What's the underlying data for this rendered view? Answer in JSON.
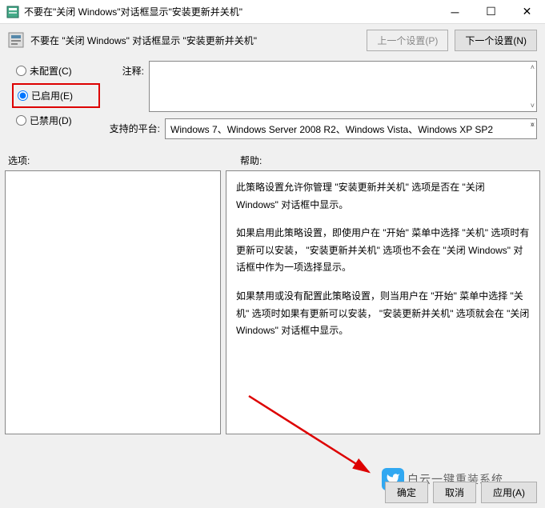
{
  "title": "不要在\"关闭 Windows\"对话框显示\"安装更新并关机\"",
  "header_title": "不要在 \"关闭 Windows\" 对话框显示 \"安装更新并关机\"",
  "nav": {
    "prev": "上一个设置(P)",
    "next": "下一个设置(N)"
  },
  "radios": {
    "not_configured": "未配置(C)",
    "enabled": "已启用(E)",
    "disabled": "已禁用(D)"
  },
  "labels": {
    "comment": "注释:",
    "platform": "支持的平台:",
    "options": "选项:",
    "help": "帮助:"
  },
  "platform_text": "Windows 7、Windows Server 2008 R2、Windows Vista、Windows XP SP2",
  "help_paragraphs": [
    "此策略设置允许你管理 \"安装更新并关机\" 选项是否在 \"关闭 Windows\" 对话框中显示。",
    "如果启用此策略设置，即使用户在 \"开始\" 菜单中选择 \"关机\" 选项时有更新可以安装， \"安装更新并关机\" 选项也不会在 \"关闭 Windows\" 对话框中作为一项选择显示。",
    "如果禁用或没有配置此策略设置，则当用户在 \"开始\" 菜单中选择 \"关机\" 选项时如果有更新可以安装， \"安装更新并关机\" 选项就会在 \"关闭 Windows\" 对话框中显示。"
  ],
  "footer": {
    "ok": "确定",
    "cancel": "取消",
    "apply": "应用(A)"
  },
  "watermark": "白云一键重装系统"
}
